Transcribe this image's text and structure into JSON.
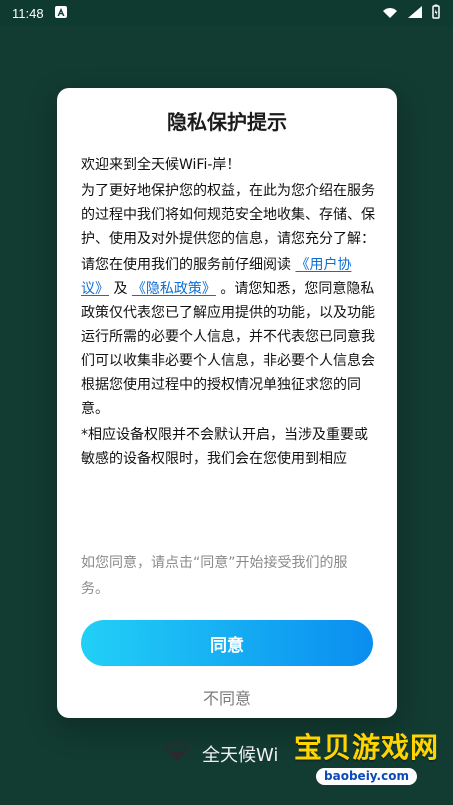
{
  "status": {
    "time": "11:48",
    "notification_icon": "a-icon",
    "wifi_icon": "wifi-icon",
    "signal_icon": "signal-icon",
    "battery_icon": "battery-icon"
  },
  "dialog": {
    "title": "隐私保护提示",
    "content": {
      "p1": "欢迎来到全天候WiFi-岸！",
      "p2": "为了更好地保护您的权益，在此为您介绍在服务的过程中我们将如何规范安全地收集、存储、保护、使用及对外提供您的信息，请您充分了解：",
      "p3_prefix": "请您在使用我们的服务前仔细阅读",
      "p3_user_agreement": "《用户协议》",
      "p3_and": "及",
      "p3_privacy_policy": "《隐私政策》",
      "p3_suffix": "。请您知悉，您同意隐私政策仅代表您已了解应用提供的功能，以及功能运行所需的必要个人信息，并不代表您已同意我们可以收集非必要个人信息，非必要个人信息会根据您使用过程中的授权情况单独征求您的同意。",
      "p4": "*相应设备权限并不会默认开启，当涉及重要或敏感的设备权限时，我们会在您使用到相应"
    },
    "hint": "如您同意，请点击“同意”开始接受我们的服务。",
    "agree": "同意",
    "disagree": "不同意"
  },
  "background": {
    "brand_text": "全天候Wi"
  },
  "watermark": {
    "title": "宝贝游戏网",
    "url": "baobeiy.com"
  }
}
